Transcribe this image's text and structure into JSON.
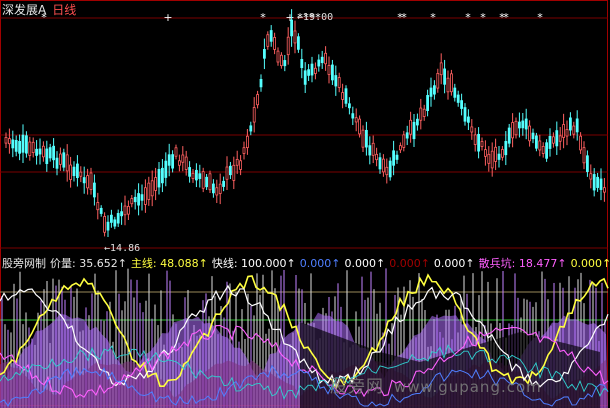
{
  "chart_data": [
    {
      "type": "candlestick",
      "title": "深发展A",
      "period": "日线",
      "max_label": "19.00",
      "min_label": "14.86",
      "grid": true,
      "colors": {
        "up": "#ff6060",
        "down": "#54ffff"
      },
      "signal_marks": [
        "*",
        "+",
        "*",
        "+",
        "*",
        "*",
        "*",
        "*",
        "*",
        "*",
        "*",
        "*",
        "*",
        "*",
        "*",
        "*",
        "*"
      ]
    },
    {
      "type": "line",
      "title": "股旁网制",
      "series": [
        {
          "name": "价量",
          "value": "35.652",
          "color": "#e8e8e8"
        },
        {
          "name": "主线",
          "value": "48.088",
          "color": "#ffff40"
        },
        {
          "name": "快线",
          "value": "100.000",
          "color": "#ffffff"
        },
        {
          "name": "",
          "value": "0.000",
          "color": "#4f7fff"
        },
        {
          "name": "",
          "value": "0.000",
          "color": "#ffffff"
        },
        {
          "name": "",
          "value": "0.000",
          "color": "#a00000"
        },
        {
          "name": "",
          "value": "0.000",
          "color": "#ffffff"
        },
        {
          "name": "散兵坑",
          "value": "18.477",
          "color": "#ff60ff"
        },
        {
          "name": "",
          "value": "0.000",
          "color": "#ffff40"
        }
      ],
      "arrow": "↑"
    }
  ],
  "watermark": {
    "text": "股旁网",
    "url": "www.gupang.com"
  }
}
